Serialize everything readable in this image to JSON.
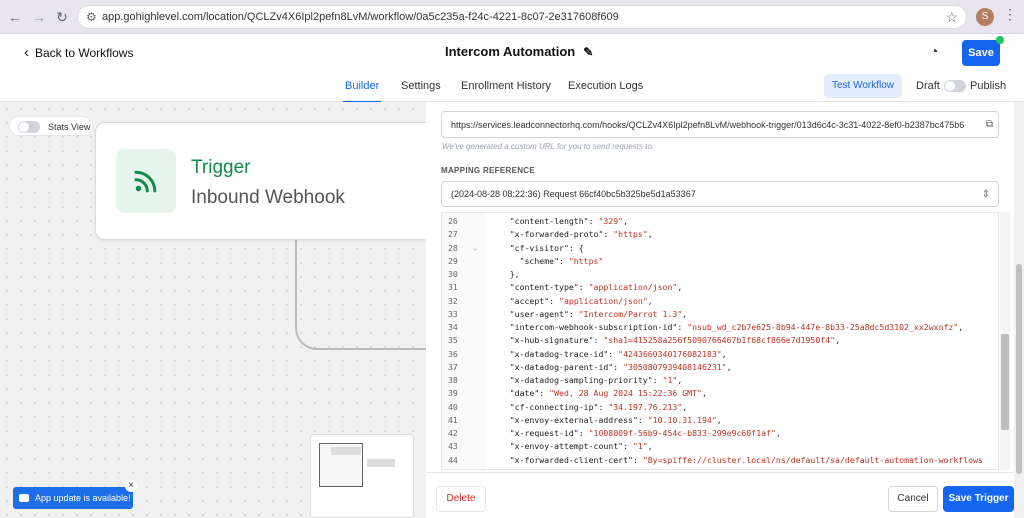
{
  "browser": {
    "url": "app.gohighlevel.com/location/QCLZv4X6Ipl2pefn8LvM/workflow/0a5c235a-f24c-4221-8c07-2e317608f609",
    "profile_initial": "S"
  },
  "header": {
    "back_label": "Back to Workflows",
    "title": "Intercom Automation",
    "save_label": "Save"
  },
  "tabs": [
    "Builder",
    "Settings",
    "Enrollment History",
    "Execution Logs"
  ],
  "tabs_active": "Builder",
  "toolbar": {
    "test_workflow": "Test Workflow",
    "draft": "Draft",
    "publish": "Publish"
  },
  "canvas": {
    "stats_view": "Stats View",
    "trigger_label": "Trigger",
    "trigger_name": "Inbound Webhook",
    "toast": "App update is available!"
  },
  "panel": {
    "webhook_url": "https://services.leadconnectorhq.com/hooks/QCLZv4X6Ipl2pefn8LvM/webhook-trigger/013d6c4c-3c31-4022-8ef0-b2387bc475b6",
    "hint": "We've generated a custom URL for you to send requests to.",
    "mapping_reference": "MAPPING REFERENCE",
    "selected_request": "(2024-08-28 08:22:36) Request 66cf40bc5b325be5d1a53367",
    "code_lines": [
      {
        "n": "26",
        "k": "    \"content-length\": ",
        "v": "\"329\"",
        "t": ","
      },
      {
        "n": "27",
        "k": "    \"x-forwarded-proto\": ",
        "v": "\"https\"",
        "t": ","
      },
      {
        "n": "28",
        "k": "    \"cf-visitor\": {",
        "v": "",
        "t": ""
      },
      {
        "n": "29",
        "k": "      \"scheme\": ",
        "v": "\"https\"",
        "t": ""
      },
      {
        "n": "30",
        "k": "    },",
        "v": "",
        "t": ""
      },
      {
        "n": "31",
        "k": "    \"content-type\": ",
        "v": "\"application/json\"",
        "t": ","
      },
      {
        "n": "32",
        "k": "    \"accept\": ",
        "v": "\"application/json\"",
        "t": ","
      },
      {
        "n": "33",
        "k": "    \"user-agent\": ",
        "v": "\"Intercom/Parrot 1.3\"",
        "t": ","
      },
      {
        "n": "34",
        "k": "    \"intercom-webhook-subscription-id\": ",
        "v": "\"nsub_wd_c2b7e625-8b94-447e-8b33-25a8dc5d3102_xx2wxnfz\"",
        "t": ","
      },
      {
        "n": "35",
        "k": "    \"x-hub-signature\": ",
        "v": "\"sha1=415258a256f5090766467b1f68cf866e7d1950f4\"",
        "t": ","
      },
      {
        "n": "36",
        "k": "    \"x-datadog-trace-id\": ",
        "v": "\"4243660340176082183\"",
        "t": ","
      },
      {
        "n": "37",
        "k": "    \"x-datadog-parent-id\": ",
        "v": "\"3050807939408146231\"",
        "t": ","
      },
      {
        "n": "38",
        "k": "    \"x-datadog-sampling-priority\": ",
        "v": "\"1\"",
        "t": ","
      },
      {
        "n": "39",
        "k": "    \"date\": ",
        "v": "\"Wed, 28 Aug 2024 15:22:36 GMT\"",
        "t": ","
      },
      {
        "n": "40",
        "k": "    \"cf-connecting-ip\": ",
        "v": "\"34.197.76.213\"",
        "t": ","
      },
      {
        "n": "41",
        "k": "    \"x-envoy-external-address\": ",
        "v": "\"10.10.31.194\"",
        "t": ","
      },
      {
        "n": "42",
        "k": "    \"x-request-id\": ",
        "v": "\"1008009f-56b9-454c-b833-299e9c60f1af\"",
        "t": ","
      },
      {
        "n": "43",
        "k": "    \"x-envoy-attempt-count\": ",
        "v": "\"1\"",
        "t": ","
      },
      {
        "n": "44",
        "k": "    \"x-forwarded-client-cert\": ",
        "v": "\"By=spiffe://cluster.local/ns/default/sa/default-automation-workflows",
        "t": ""
      }
    ],
    "delete": "Delete",
    "cancel": "Cancel",
    "save_trigger": "Save Trigger"
  },
  "colors": {
    "accent": "#1565f0",
    "trigger_green": "#128a4b",
    "string_red": "#c03221"
  }
}
